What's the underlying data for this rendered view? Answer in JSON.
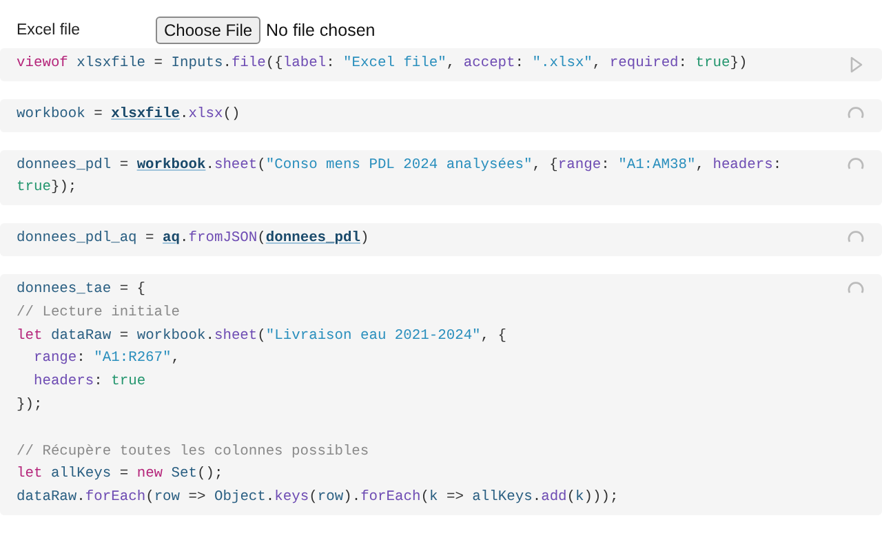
{
  "file_input": {
    "label": "Excel file",
    "button": "Choose File",
    "status": "No file chosen"
  },
  "cells": [
    {
      "pending": false,
      "blocks": [
        {
          "lines": [
            [
              {
                "kind": "keyword",
                "text": "viewof "
              },
              {
                "kind": "name",
                "text": "xlsxfile"
              },
              {
                "kind": "plain",
                "text": " = "
              },
              {
                "kind": "name",
                "text": "Inputs"
              },
              {
                "kind": "plain",
                "text": "."
              },
              {
                "kind": "prop",
                "text": "file"
              },
              {
                "kind": "plain",
                "text": "({"
              },
              {
                "kind": "prop",
                "text": "label"
              },
              {
                "kind": "plain",
                "text": ": "
              },
              {
                "kind": "string",
                "text": "\"Excel file\""
              },
              {
                "kind": "plain",
                "text": ", "
              },
              {
                "kind": "prop",
                "text": "accept"
              },
              {
                "kind": "plain",
                "text": ": "
              },
              {
                "kind": "string",
                "text": "\".xlsx\""
              },
              {
                "kind": "plain",
                "text": ", "
              },
              {
                "kind": "prop",
                "text": "required"
              },
              {
                "kind": "plain",
                "text": ": "
              },
              {
                "kind": "bool",
                "text": "true"
              },
              {
                "kind": "plain",
                "text": "})"
              }
            ]
          ]
        }
      ]
    },
    {
      "pending": true,
      "blocks": [
        {
          "lines": [
            [
              {
                "kind": "name",
                "text": "workbook"
              },
              {
                "kind": "plain",
                "text": " = "
              },
              {
                "kind": "ref",
                "text": "xlsxfile"
              },
              {
                "kind": "plain",
                "text": "."
              },
              {
                "kind": "prop",
                "text": "xlsx"
              },
              {
                "kind": "plain",
                "text": "()"
              }
            ]
          ]
        }
      ]
    },
    {
      "pending": true,
      "blocks": [
        {
          "lines": [
            [
              {
                "kind": "name",
                "text": "donnees_pdl"
              },
              {
                "kind": "plain",
                "text": " = "
              },
              {
                "kind": "ref",
                "text": "workbook"
              },
              {
                "kind": "plain",
                "text": "."
              },
              {
                "kind": "prop",
                "text": "sheet"
              },
              {
                "kind": "plain",
                "text": "("
              },
              {
                "kind": "string",
                "text": "\"Conso mens PDL 2024 analysées\""
              },
              {
                "kind": "plain",
                "text": ", {"
              },
              {
                "kind": "prop",
                "text": "range"
              },
              {
                "kind": "plain",
                "text": ": "
              },
              {
                "kind": "string",
                "text": "\"A1:AM38\""
              },
              {
                "kind": "plain",
                "text": ", "
              },
              {
                "kind": "prop",
                "text": "headers"
              },
              {
                "kind": "plain",
                "text": ":"
              }
            ],
            [
              {
                "kind": "bool",
                "text": "true"
              },
              {
                "kind": "plain",
                "text": "});"
              }
            ]
          ]
        }
      ]
    },
    {
      "pending": true,
      "blocks": [
        {
          "lines": [
            [
              {
                "kind": "name",
                "text": "donnees_pdl_aq"
              },
              {
                "kind": "plain",
                "text": " = "
              },
              {
                "kind": "ref",
                "text": "aq"
              },
              {
                "kind": "plain",
                "text": "."
              },
              {
                "kind": "prop",
                "text": "fromJSON"
              },
              {
                "kind": "plain",
                "text": "("
              },
              {
                "kind": "ref",
                "text": "donnees_pdl"
              },
              {
                "kind": "plain",
                "text": ")"
              }
            ]
          ]
        }
      ]
    },
    {
      "pending": true,
      "blocks": [
        {
          "lines": [
            [
              {
                "kind": "name",
                "text": "donnees_tae"
              },
              {
                "kind": "plain",
                "text": " = {"
              }
            ],
            [
              {
                "kind": "comment",
                "text": "// Lecture initiale"
              }
            ],
            [
              {
                "kind": "keyword",
                "text": "let "
              },
              {
                "kind": "name",
                "text": "dataRaw"
              },
              {
                "kind": "plain",
                "text": " = "
              },
              {
                "kind": "name",
                "text": "workbook"
              },
              {
                "kind": "plain",
                "text": "."
              },
              {
                "kind": "prop",
                "text": "sheet"
              },
              {
                "kind": "plain",
                "text": "("
              },
              {
                "kind": "string",
                "text": "\"Livraison eau 2021-2024\""
              },
              {
                "kind": "plain",
                "text": ", {"
              }
            ],
            [
              {
                "kind": "prop",
                "text": "  range"
              },
              {
                "kind": "plain",
                "text": ": "
              },
              {
                "kind": "string",
                "text": "\"A1:R267\""
              },
              {
                "kind": "plain",
                "text": ","
              }
            ],
            [
              {
                "kind": "prop",
                "text": "  headers"
              },
              {
                "kind": "plain",
                "text": ": "
              },
              {
                "kind": "bool",
                "text": "true"
              }
            ],
            [
              {
                "kind": "plain",
                "text": "});"
              }
            ]
          ]
        },
        {
          "lines": [
            [
              {
                "kind": "comment",
                "text": "// Récupère toutes les colonnes possibles"
              }
            ],
            [
              {
                "kind": "keyword",
                "text": "let "
              },
              {
                "kind": "name",
                "text": "allKeys"
              },
              {
                "kind": "plain",
                "text": " = "
              },
              {
                "kind": "keyword",
                "text": "new "
              },
              {
                "kind": "name",
                "text": "Set"
              },
              {
                "kind": "plain",
                "text": "();"
              }
            ],
            [
              {
                "kind": "name",
                "text": "dataRaw"
              },
              {
                "kind": "plain",
                "text": "."
              },
              {
                "kind": "prop",
                "text": "forEach"
              },
              {
                "kind": "plain",
                "text": "("
              },
              {
                "kind": "name",
                "text": "row"
              },
              {
                "kind": "plain",
                "text": " => "
              },
              {
                "kind": "name",
                "text": "Object"
              },
              {
                "kind": "plain",
                "text": "."
              },
              {
                "kind": "prop",
                "text": "keys"
              },
              {
                "kind": "plain",
                "text": "("
              },
              {
                "kind": "name",
                "text": "row"
              },
              {
                "kind": "plain",
                "text": ")."
              },
              {
                "kind": "prop",
                "text": "forEach"
              },
              {
                "kind": "plain",
                "text": "("
              },
              {
                "kind": "name",
                "text": "k"
              },
              {
                "kind": "plain",
                "text": " => "
              },
              {
                "kind": "name",
                "text": "allKeys"
              },
              {
                "kind": "plain",
                "text": "."
              },
              {
                "kind": "prop",
                "text": "add"
              },
              {
                "kind": "plain",
                "text": "("
              },
              {
                "kind": "name",
                "text": "k"
              },
              {
                "kind": "plain",
                "text": ")));"
              }
            ]
          ]
        }
      ]
    }
  ]
}
